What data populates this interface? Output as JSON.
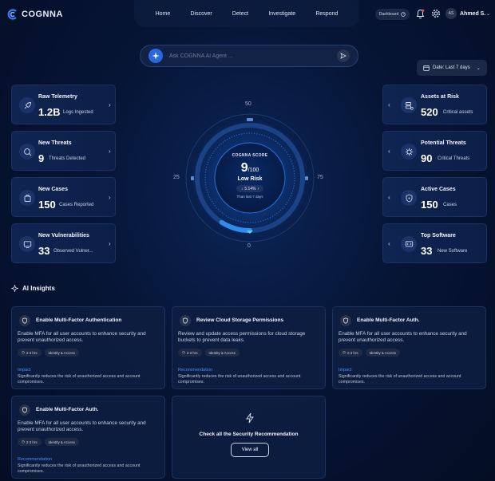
{
  "app": {
    "brand": "COGNNA"
  },
  "nav": {
    "items": [
      "Home",
      "Discover",
      "Detect",
      "Investigate",
      "Respond"
    ]
  },
  "header": {
    "dashboard_label": "Dashboard",
    "user_initials": "AS",
    "user_name": "Ahmed S."
  },
  "search": {
    "placeholder": "Ask COGNNA AI Agent ..."
  },
  "date_filter": {
    "label": "Date: Last 7 days"
  },
  "left_stats": [
    {
      "title": "Raw Telemetry",
      "value": "1.2B",
      "sub": "Logs Ingested",
      "icon": "rocket-icon"
    },
    {
      "title": "New Threats",
      "value": "9",
      "sub": "Threats Detected",
      "icon": "search-threat-icon"
    },
    {
      "title": "New Cases",
      "value": "150",
      "sub": "Cases Reported",
      "icon": "case-icon"
    },
    {
      "title": "New Vulnerabilities",
      "value": "33",
      "sub": "Observed Vulner...",
      "icon": "monitor-alert-icon"
    }
  ],
  "right_stats": [
    {
      "title": "Assets at Risk",
      "value": "520",
      "sub": "Critical assets",
      "icon": "server-alert-icon"
    },
    {
      "title": "Potential Threats",
      "value": "90",
      "sub": "Critical Threats",
      "icon": "virus-icon"
    },
    {
      "title": "Active Cases",
      "value": "150",
      "sub": "Cases",
      "icon": "shield-icon"
    },
    {
      "title": "Top Software",
      "value": "33",
      "sub": "New Software",
      "icon": "software-icon"
    }
  ],
  "score": {
    "label": "COGNNA SCORE",
    "value": "9",
    "max": "/100",
    "fraction": 0.09,
    "risk": "Low Risk",
    "change": "5.14%",
    "change_note": "Than last 7 days",
    "axis": {
      "top": "50",
      "left": "25",
      "right": "75",
      "bottom": "0"
    }
  },
  "insights": {
    "title": "AI Insights",
    "cards": [
      {
        "title": "Enable Multi-Factor Authentication",
        "desc": "Enable MFA for all user accounts to enhance security and prevent unauthorized access.",
        "time": "2-3 hrs",
        "tag": "Identity & Access",
        "label": "Impact",
        "label_desc": "Significantly reduces the risk of unauthorized access and account compromises."
      },
      {
        "title": "Review Cloud Storage Permissions",
        "desc": "Review and update access permissions for cloud storage buckets to prevent data leaks.",
        "time": "2-3 hrs",
        "tag": "Identity & Access",
        "label": "Recommendation",
        "label_desc": "Significantly reduces the risk of unauthorized access and account compromises."
      },
      {
        "title": "Enable Multi-Factor Auth.",
        "desc": "Enable MFA for all user accounts to enhance security and prevent unauthorized access.",
        "time": "2-3 hrs",
        "tag": "Identity & Access",
        "label": "Impact",
        "label_desc": "Significantly reduces the risk of unauthorized access and account compromises."
      },
      {
        "title": "Enable Multi-Factor Auth.",
        "desc": "Enable MFA for all user accounts to enhance security and prevent unauthorized access.",
        "time": "2-3 hrs",
        "tag": "Identity & Access",
        "label": "Recommendation",
        "label_desc": "Significantly reduces the risk of unauthorized access and account compromises."
      }
    ],
    "cta": {
      "message": "Check all the Security Recommendation",
      "button": "View all"
    }
  },
  "colors": {
    "accent": "#2b68e0",
    "link": "#4c8df6",
    "background": "#061536"
  }
}
